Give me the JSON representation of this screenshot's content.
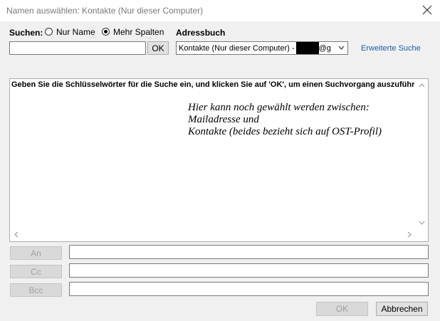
{
  "window": {
    "title": "Namen auswählen: Kontakte (Nur dieser Computer)"
  },
  "search": {
    "label": "Suchen:",
    "options": [
      {
        "label": "Nur Name",
        "selected": false
      },
      {
        "label": "Mehr Spalten",
        "selected": true
      }
    ],
    "value": "",
    "ok_label": "OK"
  },
  "addressbook": {
    "label": "Adressbuch",
    "selected_prefix": "Kontakte (Nur dieser Computer) -",
    "selected_suffix": "@g",
    "advanced_link": "Erweiterte Suche"
  },
  "results": {
    "header": "Geben Sie die Schlüsselwörter für die Suche ein, und klicken Sie auf 'OK', um einen Suchvorgang auszuführ...",
    "annotation_lines": [
      "Hier kann noch gewählt werden zwischen:",
      "Mailadresse und",
      "Kontakte (beides bezieht sich auf OST-Profil)"
    ]
  },
  "recipients": [
    {
      "label": "An",
      "value": ""
    },
    {
      "label": "Cc",
      "value": ""
    },
    {
      "label": "Bcc",
      "value": ""
    }
  ],
  "footer": {
    "ok_label": "OK",
    "cancel_label": "Abbrechen"
  },
  "icons": {
    "close": "close-icon",
    "dropdown": "chevron-down-icon",
    "scroll_up": "arrow-up-icon",
    "scroll_down": "arrow-down-icon",
    "scroll_left": "arrow-left-icon",
    "scroll_right": "arrow-right-icon"
  }
}
